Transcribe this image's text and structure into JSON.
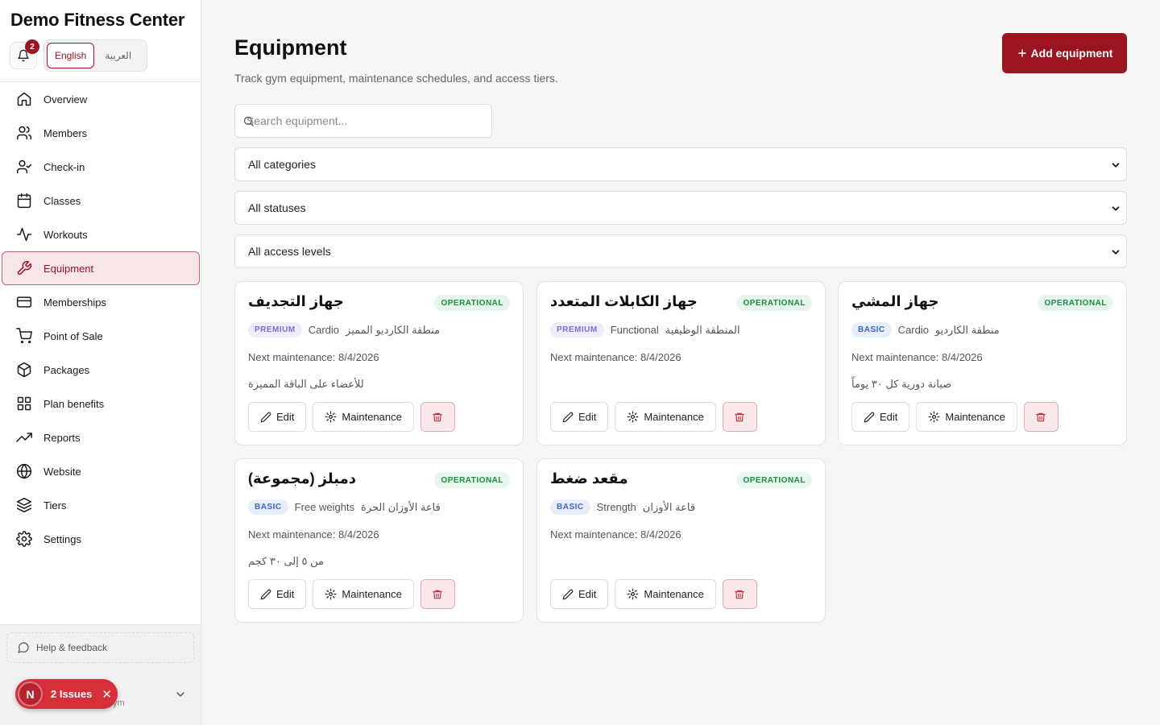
{
  "sidebar": {
    "brand": "Demo Fitness Center",
    "notifications_count": "2",
    "languages": [
      "English",
      "العربية"
    ],
    "items": [
      {
        "label": "Overview",
        "icon": "home-icon"
      },
      {
        "label": "Members",
        "icon": "users-icon"
      },
      {
        "label": "Check-in",
        "icon": "user-check-icon"
      },
      {
        "label": "Classes",
        "icon": "calendar-icon"
      },
      {
        "label": "Workouts",
        "icon": "activity-icon"
      },
      {
        "label": "Equipment",
        "icon": "wrench-icon",
        "active": true
      },
      {
        "label": "Memberships",
        "icon": "credit-card-icon"
      },
      {
        "label": "Point of Sale",
        "icon": "cart-icon"
      },
      {
        "label": "Packages",
        "icon": "package-icon"
      },
      {
        "label": "Plan benefits",
        "icon": "grid-icon"
      },
      {
        "label": "Reports",
        "icon": "trending-up-icon"
      },
      {
        "label": "Website",
        "icon": "globe-icon"
      },
      {
        "label": "Tiers",
        "icon": "layers-icon"
      },
      {
        "label": "Settings",
        "icon": "gear-icon"
      }
    ],
    "help_label": "Help & feedback",
    "user_sub": "ym",
    "issues": {
      "avatar": "N",
      "label": "2 Issues"
    }
  },
  "main": {
    "title": "Equipment",
    "subtitle": "Track gym equipment, maintenance schedules, and access tiers.",
    "add_button": "Add equipment",
    "search_placeholder": "Search equipment...",
    "filters": {
      "category": "All categories",
      "status": "All statuses",
      "access": "All access levels"
    },
    "actions": {
      "edit": "Edit",
      "maintenance": "Maintenance"
    },
    "cards": [
      {
        "name": "جهاز التجديف",
        "status": "OPERATIONAL",
        "tier": "PREMIUM",
        "category": "Cardio",
        "zone": "منطقة الكارديو المميز",
        "next": "Next maintenance: 8/4/2026",
        "note": "للأعضاء على الباقة المميزة"
      },
      {
        "name": "جهاز الكابلات المتعدد",
        "status": "OPERATIONAL",
        "tier": "PREMIUM",
        "category": "Functional",
        "zone": "المنطقة الوظيفية",
        "next": "Next maintenance: 8/4/2026",
        "note": ""
      },
      {
        "name": "جهاز المشي",
        "status": "OPERATIONAL",
        "tier": "BASIC",
        "category": "Cardio",
        "zone": "منطقة الكارديو",
        "next": "Next maintenance: 8/4/2026",
        "note": "صيانة دورية كل ٣٠ يوماً"
      },
      {
        "name": "دمبلز (مجموعة)",
        "status": "OPERATIONAL",
        "tier": "BASIC",
        "category": "Free weights",
        "zone": "قاعة الأوزان الحرة",
        "next": "Next maintenance: 8/4/2026",
        "note": "من ٥ إلى ٣٠ كجم"
      },
      {
        "name": "مقعد ضغط",
        "status": "OPERATIONAL",
        "tier": "BASIC",
        "category": "Strength",
        "zone": "قاعة الأوزان",
        "next": "Next maintenance: 8/4/2026",
        "note": ""
      }
    ]
  },
  "colors": {
    "brand": "#9b1422",
    "operational": "#1f8a48",
    "premium": "#7b6fd6",
    "basic": "#3d63c9"
  }
}
